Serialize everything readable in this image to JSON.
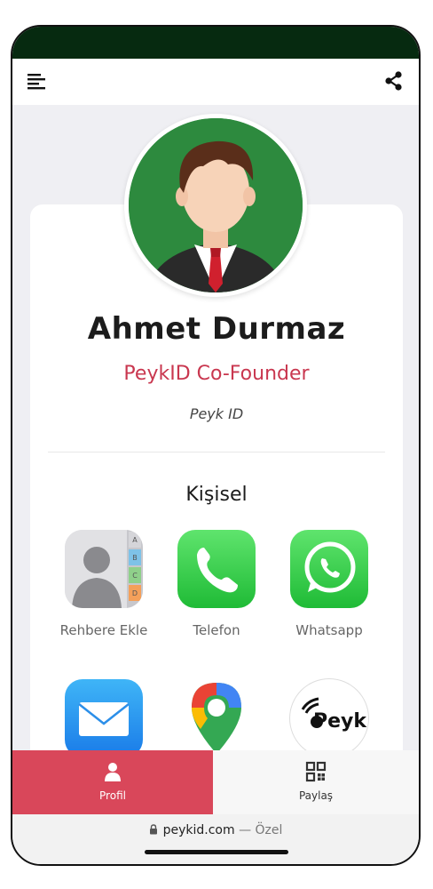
{
  "profile": {
    "name": "Ahmet Durmaz",
    "role": "PeykID Co-Founder",
    "company": "Peyk ID"
  },
  "section": {
    "title": "Kişisel"
  },
  "tiles": [
    {
      "label": "Rehbere Ekle",
      "icon": "contacts-icon"
    },
    {
      "label": "Telefon",
      "icon": "phone-icon"
    },
    {
      "label": "Whatsapp",
      "icon": "whatsapp-icon"
    },
    {
      "label": "",
      "icon": "mail-icon"
    },
    {
      "label": "",
      "icon": "google-maps-icon"
    },
    {
      "label": "",
      "icon": "peyk-logo-icon",
      "logo_text": "Peyk"
    }
  ],
  "contacts_tabs": [
    "A",
    "B",
    "C",
    "D"
  ],
  "bottom_nav": {
    "profil": "Profil",
    "paylas": "Paylaş"
  },
  "browser": {
    "url": "peykid.com",
    "privacy": "— Özel"
  },
  "colors": {
    "accent": "#c9374f",
    "nav_active": "#d9475a",
    "status_bar": "#062a10",
    "avatar_bg": "#2d8a3e"
  }
}
